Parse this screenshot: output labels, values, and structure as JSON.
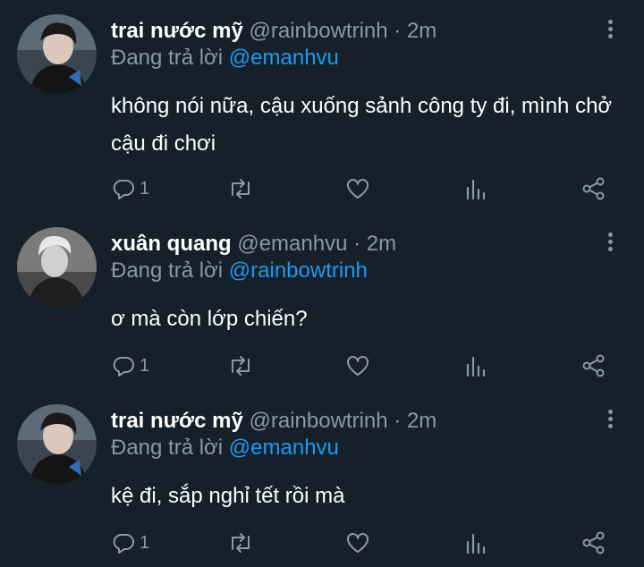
{
  "colors": {
    "background": "#15202b",
    "primary_text": "#ffffff",
    "secondary_text": "#8b98a5",
    "accent": "#1d9bf0"
  },
  "tweets": [
    {
      "display_name": "trai nước mỹ",
      "handle": "@rainbowtrinh",
      "separator": "·",
      "time": "2m",
      "reply_prefix": "Đang trả lời",
      "reply_to": "@emanhvu",
      "text": "không nói nữa, cậu xuống sảnh công ty đi, mình chở cậu đi chơi",
      "reply_count": "1",
      "avatar_icon": "profile-photo-icon"
    },
    {
      "display_name": "xuân quang",
      "handle": "@emanhvu",
      "separator": "·",
      "time": "2m",
      "reply_prefix": "Đang trả lời",
      "reply_to": "@rainbowtrinh",
      "text": "ơ mà còn lớp chiến?",
      "reply_count": "1",
      "avatar_icon": "profile-photo-icon"
    },
    {
      "display_name": "trai nước mỹ",
      "handle": "@rainbowtrinh",
      "separator": "·",
      "time": "2m",
      "reply_prefix": "Đang trả lời",
      "reply_to": "@emanhvu",
      "text": "kệ đi, sắp nghỉ tết rồi mà",
      "reply_count": "1",
      "avatar_icon": "profile-photo-icon"
    }
  ],
  "action_icons": [
    "reply-icon",
    "retweet-icon",
    "like-icon",
    "analytics-icon",
    "share-icon"
  ]
}
